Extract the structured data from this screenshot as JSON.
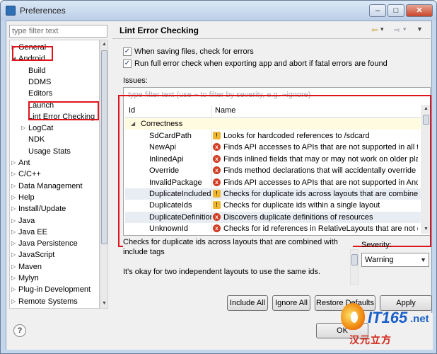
{
  "window": {
    "title": "Preferences",
    "minimize": "–",
    "maximize": "□",
    "close": "✕"
  },
  "left": {
    "filter_placeholder": "type filter text",
    "tree": [
      {
        "label": "General",
        "expander": "▷"
      },
      {
        "label": "Android",
        "expander": "◢"
      },
      {
        "label": "Build",
        "expander": ""
      },
      {
        "label": "DDMS",
        "expander": ""
      },
      {
        "label": "Editors",
        "expander": ""
      },
      {
        "label": "Launch",
        "expander": ""
      },
      {
        "label": "Lint Error Checking",
        "expander": ""
      },
      {
        "label": "LogCat",
        "expander": "▷"
      },
      {
        "label": "NDK",
        "expander": ""
      },
      {
        "label": "Usage Stats",
        "expander": ""
      },
      {
        "label": "Ant",
        "expander": "▷"
      },
      {
        "label": "C/C++",
        "expander": "▷"
      },
      {
        "label": "Data Management",
        "expander": "▷"
      },
      {
        "label": "Help",
        "expander": "▷"
      },
      {
        "label": "Install/Update",
        "expander": "▷"
      },
      {
        "label": "Java",
        "expander": "▷"
      },
      {
        "label": "Java EE",
        "expander": "▷"
      },
      {
        "label": "Java Persistence",
        "expander": "▷"
      },
      {
        "label": "JavaScript",
        "expander": "▷"
      },
      {
        "label": "Maven",
        "expander": "▷"
      },
      {
        "label": "Mylyn",
        "expander": "▷"
      },
      {
        "label": "Plug-in Development",
        "expander": "▷"
      },
      {
        "label": "Remote Systems",
        "expander": "▷"
      }
    ]
  },
  "page": {
    "title": "Lint Error Checking",
    "nav_back": "⇦",
    "nav_back_menu": "▾",
    "nav_fwd": "⇨",
    "nav_fwd_menu": "▾",
    "view_menu": "▼",
    "check_saving": {
      "checked": true,
      "mark": "✓",
      "label": "When saving files, check for errors"
    },
    "check_export": {
      "checked": true,
      "mark": "✓",
      "label": "Run full error check when exporting app and abort if fatal errors are found"
    },
    "issues_label": "Issues:",
    "table_filter_placeholder": "type filter text (use ~ to filter by severity, e.g. ~ignore)",
    "columns": {
      "id": "Id",
      "name": "Name"
    },
    "category": "Correctness",
    "category_arrow": "◢",
    "rows": [
      {
        "id": "SdCardPath",
        "severity": "warning",
        "icon": "!",
        "name": "Looks for hardcoded references to /sdcard"
      },
      {
        "id": "NewApi",
        "severity": "error",
        "icon": "x",
        "name": "Finds API accesses to APIs that are not supported in all targeted API versions"
      },
      {
        "id": "InlinedApi",
        "severity": "error",
        "icon": "x",
        "name": "Finds inlined fields that may or may not work on older platforms"
      },
      {
        "id": "Override",
        "severity": "error",
        "icon": "x",
        "name": "Finds method declarations that will accidentally override methods"
      },
      {
        "id": "InvalidPackage",
        "severity": "error",
        "icon": "x",
        "name": "Finds API accesses to APIs that are not supported in Android"
      },
      {
        "id": "DuplicateIncludedIds",
        "severity": "warning",
        "icon": "!",
        "name": "Checks for duplicate ids across layouts that are combined with include tags"
      },
      {
        "id": "DuplicateIds",
        "severity": "warning",
        "icon": "!",
        "name": "Checks for duplicate ids within a single layout"
      },
      {
        "id": "DuplicateDefinition",
        "severity": "error",
        "icon": "x",
        "name": "Discovers duplicate definitions of resources"
      },
      {
        "id": "UnknownId",
        "severity": "error",
        "icon": "x",
        "name": "Checks for id references in RelativeLayouts that are not defined elsewhere"
      }
    ],
    "description": "Checks for duplicate ids across layouts that are combined with include tags",
    "description_detail": "It's okay for two independent layouts to use the same ids.",
    "severity_label": "Severity:",
    "severity_value": "Warning",
    "buttons": {
      "include_all": "Include All",
      "ignore_all": "Ignore All",
      "restore_defaults": "Restore Defaults",
      "apply": "Apply"
    }
  },
  "bottom": {
    "help": "?",
    "ok": "OK"
  },
  "watermark": {
    "brand": "IT165",
    "tld": ".net",
    "sub": "汉元立方"
  },
  "colors": {
    "highlight_box": "#e0141c",
    "category_row": "#fffbe0",
    "error_icon": "#d23d24",
    "warning_icon": "#f0b731"
  }
}
